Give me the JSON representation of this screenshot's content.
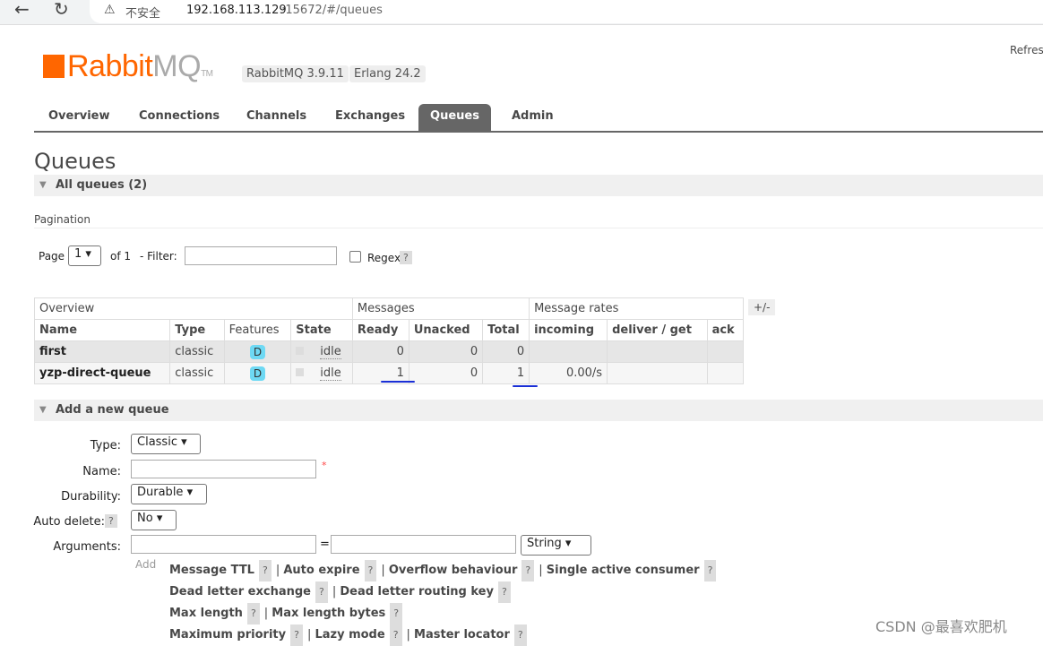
{
  "browser": {
    "security": "不安全",
    "url_host": "192.168.113.129",
    "url_rest": ":15672/#/queues"
  },
  "header": {
    "logo_a": "Rabbit",
    "logo_b": "MQ",
    "tm": "TM",
    "version": "RabbitMQ 3.9.11",
    "erlang": "Erlang 24.2",
    "refresh": "Refres"
  },
  "tabs": [
    "Overview",
    "Connections",
    "Channels",
    "Exchanges",
    "Queues",
    "Admin"
  ],
  "page_title": "Queues",
  "all_queues": "All queues (2)",
  "pagination": {
    "label": "Pagination",
    "page_label": "Page",
    "page": "1",
    "of": "of 1",
    "filter_label": "- Filter:",
    "regex": "Regex",
    "help": "?"
  },
  "table": {
    "groups": [
      "Overview",
      "Messages",
      "Message rates"
    ],
    "plusminus": "+/-",
    "headers": [
      "Name",
      "Type",
      "Features",
      "State",
      "Ready",
      "Unacked",
      "Total",
      "incoming",
      "deliver / get",
      "ack"
    ],
    "rows": [
      {
        "name": "first",
        "type": "classic",
        "feature": "D",
        "state": "idle",
        "ready": "0",
        "unacked": "0",
        "total": "0",
        "incoming": "",
        "deliver": "",
        "ack": ""
      },
      {
        "name": "yzp-direct-queue",
        "type": "classic",
        "feature": "D",
        "state": "idle",
        "ready": "1",
        "unacked": "0",
        "total": "1",
        "incoming": "0.00/s",
        "deliver": "",
        "ack": ""
      }
    ]
  },
  "add_queue": {
    "title": "Add a new queue",
    "type_label": "Type:",
    "type": "Classic",
    "name_label": "Name:",
    "required": "*",
    "durability_label": "Durability:",
    "durability": "Durable",
    "auto_delete_label": "Auto delete:",
    "auto_delete": "No",
    "arguments_label": "Arguments:",
    "eq": "=",
    "arg_type": "String",
    "add": "Add",
    "args": [
      [
        "Message TTL",
        "Auto expire",
        "Overflow behaviour",
        "Single active consumer"
      ],
      [
        "Dead letter exchange",
        "Dead letter routing key"
      ],
      [
        "Max length",
        "Max length bytes"
      ],
      [
        "Maximum priority",
        "Lazy mode",
        "Master locator"
      ]
    ]
  },
  "watermark": "CSDN @最喜欢肥机"
}
